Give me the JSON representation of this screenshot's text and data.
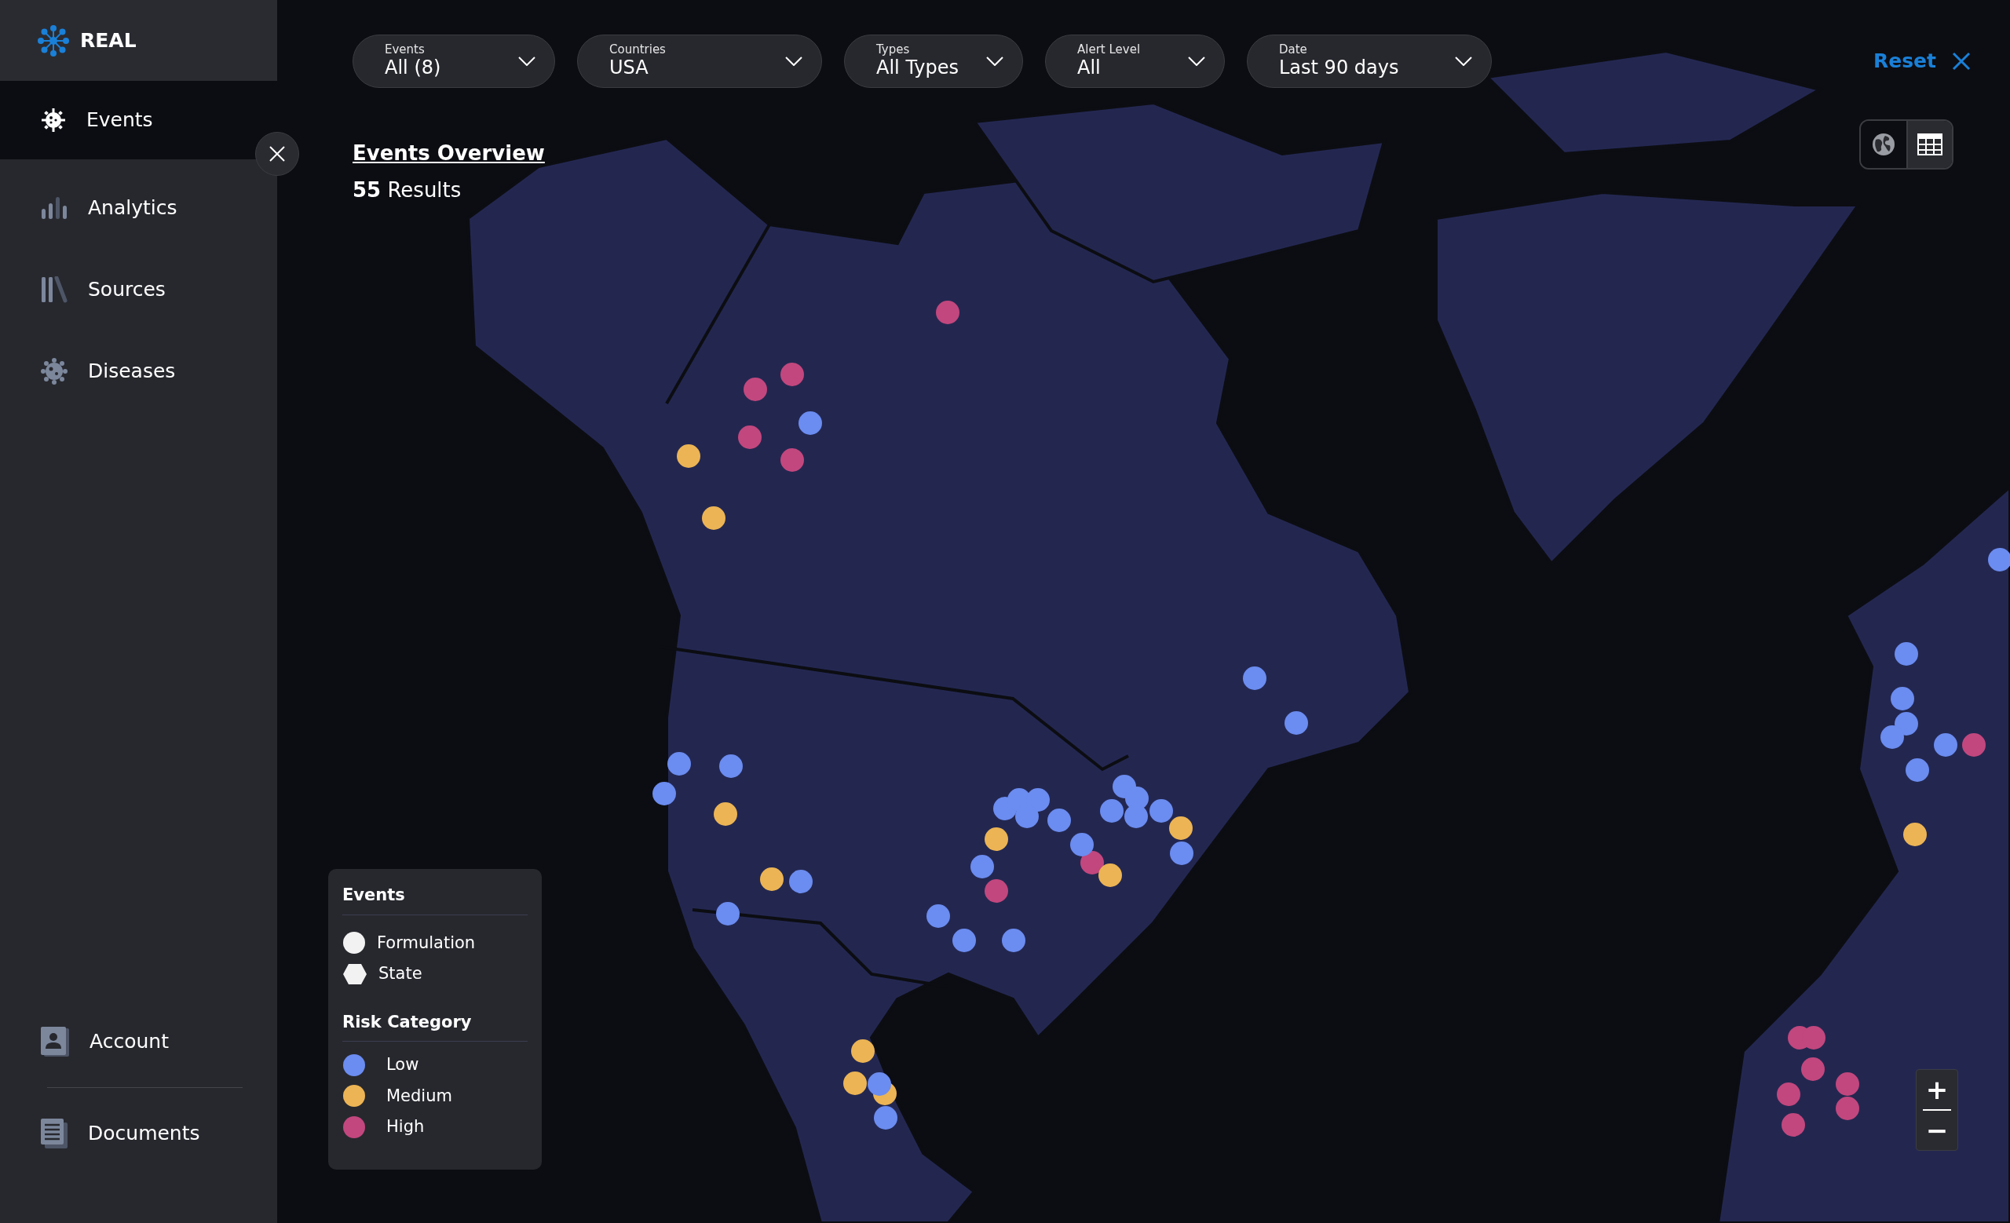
{
  "brand": "REAL",
  "nav": [
    {
      "label": "Events",
      "kind": "virus",
      "selected": true
    },
    {
      "label": "Analytics",
      "kind": "bars",
      "selected": false
    },
    {
      "label": "Sources",
      "kind": "books",
      "selected": false
    },
    {
      "label": "Diseases",
      "kind": "germ",
      "selected": false
    }
  ],
  "nav_bottom": [
    {
      "label": "Account",
      "kind": "account"
    },
    {
      "label": "Documents",
      "kind": "documents"
    }
  ],
  "filters": [
    {
      "label": "Events",
      "value": "All (8)"
    },
    {
      "label": "Countries",
      "value": "USA"
    },
    {
      "label": "Types",
      "value": "All Types"
    },
    {
      "label": "Alert Level",
      "value": "All"
    },
    {
      "label": "Date",
      "value": "Last 90 days"
    }
  ],
  "reset": "Reset",
  "title": "Events Overview",
  "results": "**55** Results",
  "view_toggle": [
    {
      "kind": "globe",
      "selected": false
    },
    {
      "kind": "table",
      "selected": true
    }
  ],
  "legend": {
    "events_title": "Events",
    "shapes": [
      {
        "label": "Formulation",
        "kind": "circle"
      },
      {
        "label": "State",
        "kind": "hexagon"
      }
    ],
    "risk_title": "Risk Category",
    "risk": [
      {
        "label": "Low",
        "color": "#6b8cf0"
      },
      {
        "label": "Medium",
        "color": "#ecb454"
      },
      {
        "label": "High",
        "color": "#c2477e"
      }
    ]
  },
  "zoom": {
    "in": "+",
    "out": "−"
  },
  "markers": [
    {
      "color": "#c2477e"
    },
    {
      "color": "#c2477e"
    },
    {
      "color": "#c2477e"
    },
    {
      "color": "#c2477e"
    },
    {
      "color": "#c2477e"
    },
    {
      "color": "#c2477e"
    },
    {
      "color": "#c2477e"
    },
    {
      "color": "#c2477e"
    },
    {
      "color": "#c2477e"
    },
    {
      "color": "#c2477e"
    },
    {
      "color": "#c2477e"
    },
    {
      "color": "#c2477e"
    },
    {
      "color": "#c2477e"
    },
    {
      "color": "#c2477e"
    },
    {
      "color": "#c2477e"
    },
    {
      "color": "#ecb454"
    },
    {
      "color": "#ecb454"
    },
    {
      "color": "#ecb454"
    },
    {
      "color": "#ecb454"
    },
    {
      "color": "#ecb454"
    },
    {
      "color": "#ecb454"
    },
    {
      "color": "#ecb454"
    },
    {
      "color": "#ecb454"
    },
    {
      "color": "#ecb454"
    },
    {
      "color": "#ecb454"
    },
    {
      "color": "#ecb454"
    },
    {
      "color": "#6b8cf0"
    },
    {
      "color": "#6b8cf0"
    },
    {
      "color": "#6b8cf0"
    },
    {
      "color": "#6b8cf0"
    },
    {
      "color": "#6b8cf0"
    },
    {
      "color": "#6b8cf0"
    },
    {
      "color": "#6b8cf0"
    },
    {
      "color": "#6b8cf0"
    },
    {
      "color": "#6b8cf0"
    },
    {
      "color": "#6b8cf0"
    },
    {
      "color": "#6b8cf0"
    },
    {
      "color": "#6b8cf0"
    },
    {
      "color": "#6b8cf0"
    },
    {
      "color": "#6b8cf0"
    },
    {
      "color": "#6b8cf0"
    },
    {
      "color": "#6b8cf0"
    },
    {
      "color": "#6b8cf0"
    },
    {
      "color": "#6b8cf0"
    },
    {
      "color": "#6b8cf0"
    },
    {
      "color": "#6b8cf0"
    },
    {
      "color": "#6b8cf0"
    },
    {
      "color": "#6b8cf0"
    },
    {
      "color": "#6b8cf0"
    },
    {
      "color": "#6b8cf0"
    },
    {
      "color": "#6b8cf0"
    },
    {
      "color": "#6b8cf0"
    },
    {
      "color": "#6b8cf0"
    },
    {
      "color": "#6b8cf0"
    },
    {
      "color": "#6b8cf0"
    },
    {
      "color": "#6b8cf0"
    },
    {
      "color": "#6b8cf0"
    },
    {
      "color": "#6b8cf0"
    },
    {
      "color": "#6b8cf0"
    }
  ]
}
